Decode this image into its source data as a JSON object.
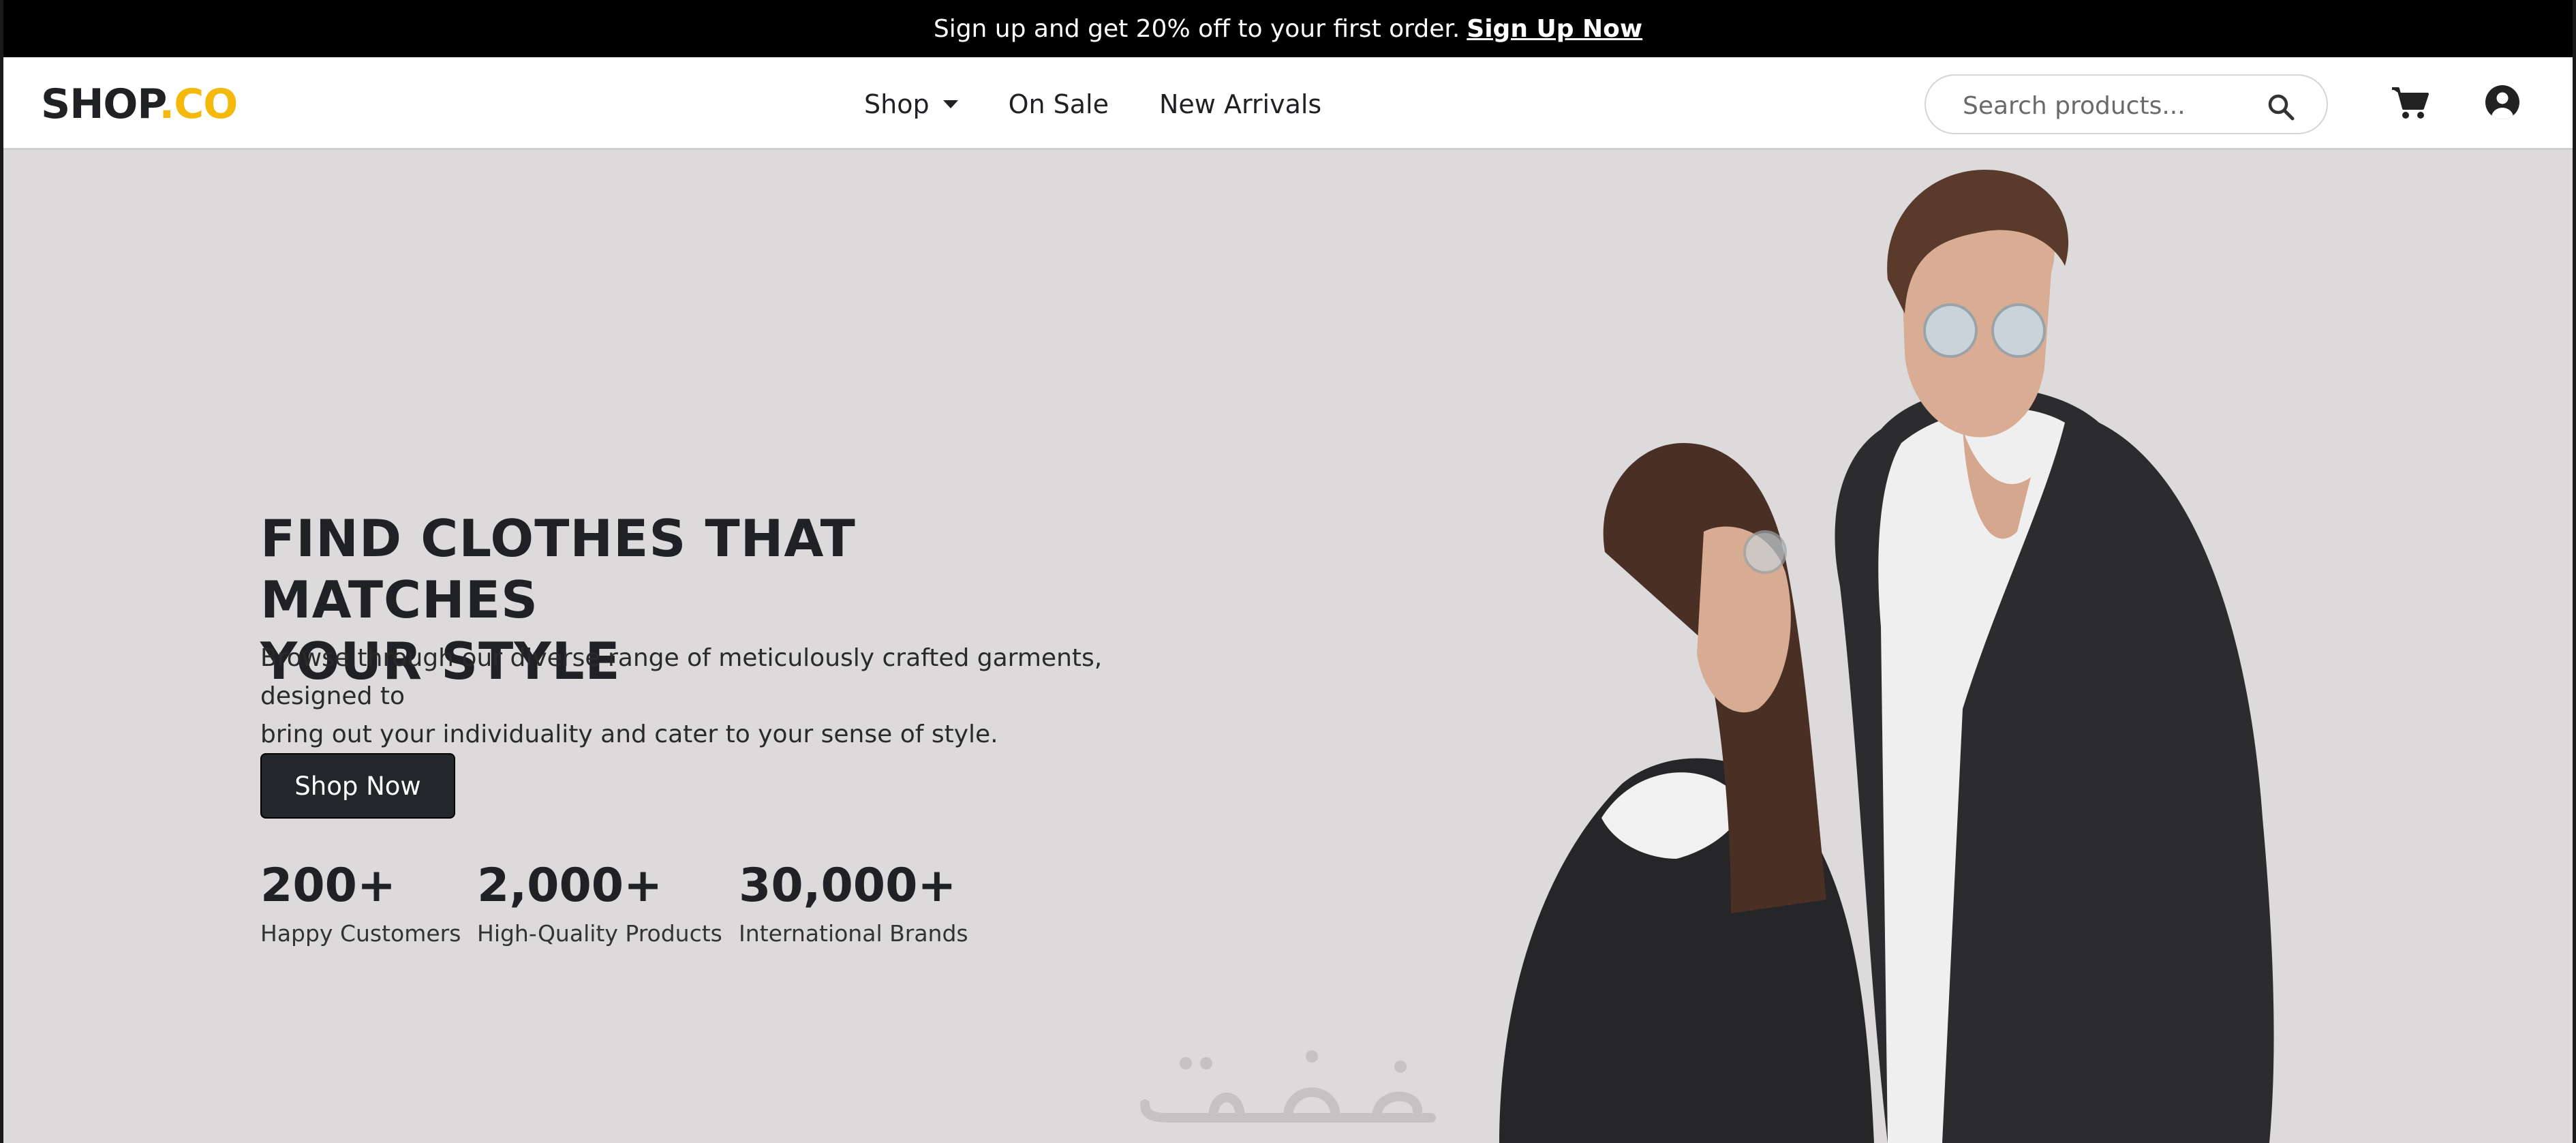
{
  "promo": {
    "text": "Sign up and get 20% off to your first order.",
    "link_label": "Sign Up Now"
  },
  "nav": {
    "logo_main": "SHOP",
    "logo_accent": ".CO",
    "links": [
      {
        "label": "Shop",
        "has_dropdown": true
      },
      {
        "label": "On Sale"
      },
      {
        "label": "New Arrivals"
      }
    ],
    "search": {
      "placeholder": "Search products...",
      "value": ""
    },
    "icons": [
      "search-icon",
      "cart-icon",
      "account-icon"
    ]
  },
  "hero": {
    "headline_line1": "FIND CLOTHES THAT MATCHES",
    "headline_line2": "YOUR STYLE",
    "description_line1": "Browse through our diverse range of meticulously crafted garments, designed to",
    "description_line2": "bring out your individuality and cater to your sense of style.",
    "cta_label": "Shop Now",
    "stats": [
      {
        "value": "200+",
        "label": "Happy Customers"
      },
      {
        "value": "2,000+",
        "label": "High-Quality Products"
      },
      {
        "value": "30,000+",
        "label": "International Brands"
      }
    ],
    "image_alt": "Couple wearing denim jackets and hoodies"
  },
  "colors": {
    "accent": "#f5b90c",
    "promo_bg": "#000000",
    "hero_bg": "#dcdadb",
    "button_bg": "#23272b"
  }
}
